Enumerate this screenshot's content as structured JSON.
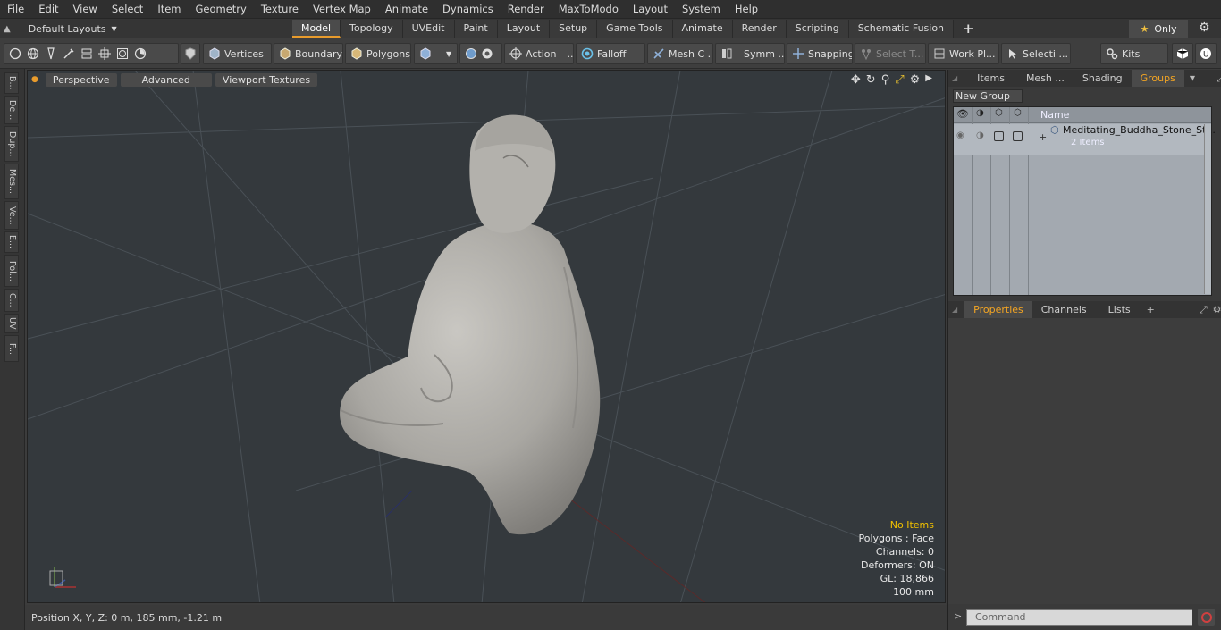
{
  "menubar": {
    "items": [
      "File",
      "Edit",
      "View",
      "Select",
      "Item",
      "Geometry",
      "Texture",
      "Vertex Map",
      "Animate",
      "Dynamics",
      "Render",
      "MaxToModo",
      "Layout",
      "System",
      "Help"
    ]
  },
  "layoutbar": {
    "default_layouts": "Default Layouts",
    "tabs": [
      "Model",
      "Topology",
      "UVEdit",
      "Paint",
      "Layout",
      "Setup",
      "Game Tools",
      "Animate",
      "Render",
      "Scripting",
      "Schematic Fusion"
    ],
    "active_tab": "Model",
    "only_label": "Only"
  },
  "toolbar": {
    "vertices": "Vertices",
    "boundary": "Boundary",
    "polygons": "Polygons",
    "action": "Action",
    "falloff": "Falloff",
    "mesh_c": "Mesh C ...",
    "symm": "Symm ...",
    "snapping": "Snapping",
    "select_t": "Select T...",
    "work_pl": "Work Pl...",
    "selecti": "Selecti ...",
    "kits": "Kits"
  },
  "left_tabs": [
    "B...",
    "De...",
    "Dup...",
    "Mes...",
    "Ve...",
    "E...",
    "Pol...",
    "C...",
    "UV",
    "F..."
  ],
  "viewport": {
    "perspective": "Perspective",
    "advanced": "Advanced",
    "viewport_textures": "Viewport Textures",
    "info": {
      "no_items": "No Items",
      "polygons": "Polygons : Face",
      "channels": "Channels: 0",
      "deformers": "Deformers: ON",
      "gl": "GL: 18,866",
      "scale": "100 mm"
    }
  },
  "statusbar": {
    "position": "Position X, Y, Z:   0 m, 185 mm, -1.21 m"
  },
  "right_panel": {
    "top_tabs": [
      "Items",
      "Mesh ...",
      "Shading",
      "Groups"
    ],
    "active_top_tab": "Groups",
    "new_group": "New Group",
    "name_header": "Name",
    "group_name": "Meditating_Buddha_Stone_St...",
    "group_count": "2 Items",
    "bottom_tabs": [
      "Properties",
      "Channels",
      "Lists"
    ],
    "active_bottom_tab": "Properties",
    "command_placeholder": "Command"
  },
  "colors": {
    "accent": "#e89b2c",
    "viewport_bg": "#34393d",
    "warning_text": "#f0c000"
  }
}
